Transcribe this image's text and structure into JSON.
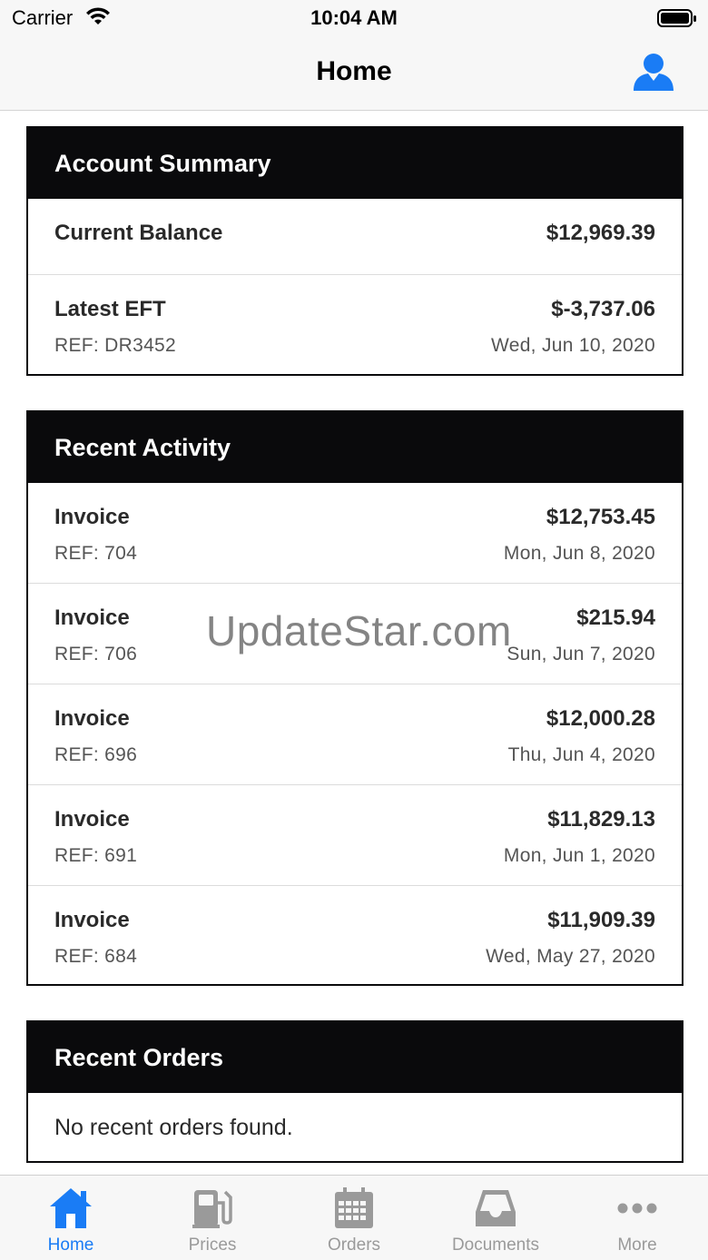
{
  "status_bar": {
    "carrier": "Carrier",
    "time": "10:04 AM"
  },
  "nav": {
    "title": "Home",
    "profile_icon": "person-icon"
  },
  "account_summary": {
    "title": "Account Summary",
    "current_balance": {
      "label": "Current Balance",
      "amount": "$12,969.39"
    },
    "latest_eft": {
      "label": "Latest EFT",
      "amount": "$-3,737.06",
      "ref": "REF: DR3452",
      "date": "Wed, Jun 10, 2020"
    }
  },
  "recent_activity": {
    "title": "Recent Activity",
    "items": [
      {
        "label": "Invoice",
        "amount": "$12,753.45",
        "ref": "REF: 704",
        "date": "Mon, Jun 8, 2020"
      },
      {
        "label": "Invoice",
        "amount": "$215.94",
        "ref": "REF: 706",
        "date": "Sun, Jun 7, 2020"
      },
      {
        "label": "Invoice",
        "amount": "$12,000.28",
        "ref": "REF: 696",
        "date": "Thu, Jun 4, 2020"
      },
      {
        "label": "Invoice",
        "amount": "$11,829.13",
        "ref": "REF: 691",
        "date": "Mon, Jun 1, 2020"
      },
      {
        "label": "Invoice",
        "amount": "$11,909.39",
        "ref": "REF: 684",
        "date": "Wed, May 27, 2020"
      }
    ]
  },
  "recent_orders": {
    "title": "Recent Orders",
    "empty_text": "No recent orders found."
  },
  "watermark": "UpdateStar.com",
  "tabs": [
    {
      "label": "Home",
      "icon": "home-icon",
      "active": true
    },
    {
      "label": "Prices",
      "icon": "fuel-pump-icon",
      "active": false
    },
    {
      "label": "Orders",
      "icon": "calendar-icon",
      "active": false
    },
    {
      "label": "Documents",
      "icon": "inbox-icon",
      "active": false
    },
    {
      "label": "More",
      "icon": "more-dots-icon",
      "active": false
    }
  ],
  "colors": {
    "accent": "#1a7cf5",
    "header_bg": "#0a0a0c",
    "inactive_tab": "#9a9a9a"
  }
}
